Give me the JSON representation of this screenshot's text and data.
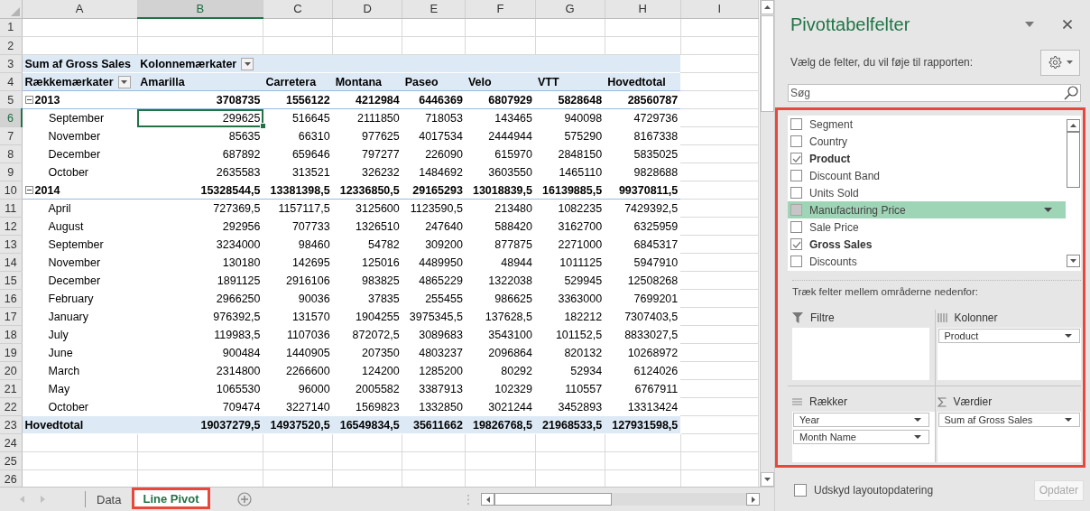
{
  "sheet": {
    "columns": [
      {
        "label": "A",
        "selected": false
      },
      {
        "label": "B",
        "selected": true
      },
      {
        "label": "C",
        "selected": false
      },
      {
        "label": "D",
        "selected": false
      },
      {
        "label": "E",
        "selected": false
      },
      {
        "label": "F",
        "selected": false
      },
      {
        "label": "G",
        "selected": false
      },
      {
        "label": "H",
        "selected": false
      },
      {
        "label": "I",
        "selected": false
      }
    ],
    "row_headers": [
      {
        "label": "1",
        "selected": false
      },
      {
        "label": "2",
        "selected": false
      },
      {
        "label": "3",
        "selected": false
      },
      {
        "label": "4",
        "selected": false
      },
      {
        "label": "5",
        "selected": false
      },
      {
        "label": "6",
        "selected": true
      },
      {
        "label": "7",
        "selected": false
      },
      {
        "label": "8",
        "selected": false
      },
      {
        "label": "9",
        "selected": false
      },
      {
        "label": "10",
        "selected": false
      },
      {
        "label": "11",
        "selected": false
      },
      {
        "label": "12",
        "selected": false
      },
      {
        "label": "13",
        "selected": false
      },
      {
        "label": "14",
        "selected": false
      },
      {
        "label": "15",
        "selected": false
      },
      {
        "label": "16",
        "selected": false
      },
      {
        "label": "17",
        "selected": false
      },
      {
        "label": "18",
        "selected": false
      },
      {
        "label": "19",
        "selected": false
      },
      {
        "label": "20",
        "selected": false
      },
      {
        "label": "21",
        "selected": false
      },
      {
        "label": "22",
        "selected": false
      },
      {
        "label": "23",
        "selected": false
      },
      {
        "label": "24",
        "selected": false
      },
      {
        "label": "25",
        "selected": false
      },
      {
        "label": "26",
        "selected": false
      }
    ]
  },
  "pivot": {
    "values_caption": "Sum af Gross Sales",
    "column_labels_caption": "Kolonnemærkater",
    "row_labels_caption": "Rækkemærkater",
    "columns": [
      "Amarilla",
      "Carretera",
      "Montana",
      "Paseo",
      "Velo",
      "VTT",
      "Hovedtotal"
    ],
    "rows": [
      {
        "kind": "year",
        "label": "2013",
        "expanded": true,
        "values": [
          "3708735",
          "1556122",
          "4212984",
          "6446369",
          "6807929",
          "5828648",
          "28560787"
        ]
      },
      {
        "kind": "month",
        "label": "September",
        "values": [
          "299625",
          "516645",
          "2111850",
          "718053",
          "143465",
          "940098",
          "4729736"
        ]
      },
      {
        "kind": "month",
        "label": "November",
        "values": [
          "85635",
          "66310",
          "977625",
          "4017534",
          "2444944",
          "575290",
          "8167338"
        ]
      },
      {
        "kind": "month",
        "label": "December",
        "values": [
          "687892",
          "659646",
          "797277",
          "226090",
          "615970",
          "2848150",
          "5835025"
        ]
      },
      {
        "kind": "month",
        "label": "October",
        "values": [
          "2635583",
          "313521",
          "326232",
          "1484692",
          "3603550",
          "1465110",
          "9828688"
        ]
      },
      {
        "kind": "year",
        "label": "2014",
        "expanded": true,
        "values": [
          "15328544,5",
          "13381398,5",
          "12336850,5",
          "29165293",
          "13018839,5",
          "16139885,5",
          "99370811,5"
        ]
      },
      {
        "kind": "month",
        "label": "April",
        "values": [
          "727369,5",
          "1157117,5",
          "3125600",
          "1123590,5",
          "213480",
          "1082235",
          "7429392,5"
        ]
      },
      {
        "kind": "month",
        "label": "August",
        "values": [
          "292956",
          "707733",
          "1326510",
          "247640",
          "588420",
          "3162700",
          "6325959"
        ]
      },
      {
        "kind": "month",
        "label": "September",
        "values": [
          "3234000",
          "98460",
          "54782",
          "309200",
          "877875",
          "2271000",
          "6845317"
        ]
      },
      {
        "kind": "month",
        "label": "November",
        "values": [
          "130180",
          "142695",
          "125016",
          "4489950",
          "48944",
          "1011125",
          "5947910"
        ]
      },
      {
        "kind": "month",
        "label": "December",
        "values": [
          "1891125",
          "2916106",
          "983825",
          "4865229",
          "1322038",
          "529945",
          "12508268"
        ]
      },
      {
        "kind": "month",
        "label": "February",
        "values": [
          "2966250",
          "90036",
          "37835",
          "255455",
          "986625",
          "3363000",
          "7699201"
        ]
      },
      {
        "kind": "month",
        "label": "January",
        "values": [
          "976392,5",
          "131570",
          "1904255",
          "3975345,5",
          "137628,5",
          "182212",
          "7307403,5"
        ]
      },
      {
        "kind": "month",
        "label": "July",
        "values": [
          "119983,5",
          "1107036",
          "872072,5",
          "3089683",
          "3543100",
          "101152,5",
          "8833027,5"
        ]
      },
      {
        "kind": "month",
        "label": "June",
        "values": [
          "900484",
          "1440905",
          "207350",
          "4803237",
          "2096864",
          "820132",
          "10268972"
        ]
      },
      {
        "kind": "month",
        "label": "March",
        "values": [
          "2314800",
          "2266600",
          "124200",
          "1285200",
          "80292",
          "52934",
          "6124026"
        ]
      },
      {
        "kind": "month",
        "label": "May",
        "values": [
          "1065530",
          "96000",
          "2005582",
          "3387913",
          "102329",
          "110557",
          "6767911"
        ]
      },
      {
        "kind": "month",
        "label": "October",
        "values": [
          "709474",
          "3227140",
          "1569823",
          "1332850",
          "3021244",
          "3452893",
          "13313424"
        ]
      },
      {
        "kind": "total",
        "label": "Hovedtotal",
        "values": [
          "19037279,5",
          "14937520,5",
          "16549834,5",
          "35611662",
          "19826768,5",
          "21968533,5",
          "127931598,5"
        ]
      }
    ]
  },
  "sheet_tabs": [
    {
      "label": "Data",
      "selected": false,
      "highlighted": false
    },
    {
      "label": "Line Pivot",
      "selected": true,
      "highlighted": true
    }
  ],
  "panel": {
    "title": "Pivottabelfelter",
    "subtitle": "Vælg de felter, du vil føje til rapporten:",
    "search": {
      "placeholder": "Søg"
    },
    "field_section": {
      "highlighted": true,
      "fields": [
        {
          "label": "Segment",
          "checked": false,
          "hovered": false
        },
        {
          "label": "Country",
          "checked": false,
          "hovered": false
        },
        {
          "label": "Product",
          "checked": true,
          "hovered": false
        },
        {
          "label": "Discount Band",
          "checked": false,
          "hovered": false
        },
        {
          "label": "Units Sold",
          "checked": false,
          "hovered": false
        },
        {
          "label": "Manufacturing Price",
          "checked": false,
          "hovered": true
        },
        {
          "label": "Sale Price",
          "checked": false,
          "hovered": false
        },
        {
          "label": "Gross Sales",
          "checked": true,
          "hovered": false
        },
        {
          "label": "Discounts",
          "checked": false,
          "hovered": false
        }
      ],
      "hint": "Træk felter mellem områderne nedenfor:",
      "areas": [
        {
          "kind": "filters",
          "label": "Filtre"
        },
        {
          "kind": "columns",
          "label": "Kolonner",
          "items": [
            "Product"
          ]
        },
        {
          "kind": "rows",
          "label": "Rækker",
          "items": [
            "Year",
            "Month Name"
          ]
        },
        {
          "kind": "values",
          "label": "Værdier",
          "items": [
            "Sum af Gross Sales"
          ]
        }
      ]
    },
    "defer_update": {
      "label": "Udskyd layoutopdatering",
      "checked": false
    },
    "update_button": {
      "label": "Opdater",
      "disabled": true
    }
  }
}
